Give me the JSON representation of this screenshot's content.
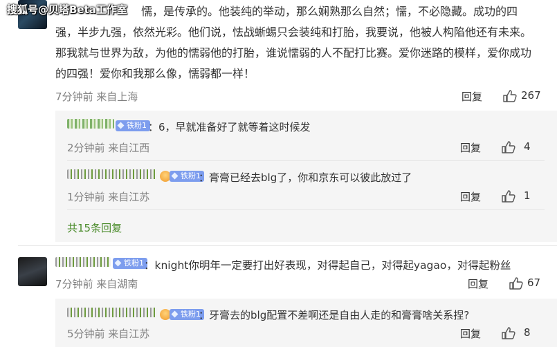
{
  "watermark": "搜狐号@贝塔Beta工作室",
  "comment1": {
    "text_lines": [
      "懦，是传承的。他装纯的举动，那么娴熟那么自然；懦，不必隐藏。成功的四",
      "强，半步九强，依然光彩。他们说，怯战蜥蜴只会装纯和打胎，我要说，他被人构陷他还有未来。",
      "那我就与世界为敌，为他的懦弱他的打胎，谁说懦弱的人不配打比赛。爱你迷路的模样，爱你成功",
      "的四强！爱你和我那么像，懦弱都一样！"
    ],
    "meta": "7分钟前 来自上海",
    "reply": "回复",
    "likes": "267"
  },
  "replies1": [
    {
      "badge": "铁粉1",
      "crown": false,
      "text": "：6，早就准备好了就等着这时候发",
      "meta": "2分钟前 来自江西",
      "reply": "回复",
      "likes": "4"
    },
    {
      "badge": "铁粉1",
      "crown": true,
      "text": "：膏膏已经去blg了，你和京东可以彼此放过了",
      "meta": "1分钟前 来自江苏",
      "reply": "回复",
      "likes": "1"
    }
  ],
  "replies1_total": "共15条回复",
  "comment2": {
    "badge": "铁粉1",
    "text": "：knight你明年一定要打出好表现，对得起自己，对得起yagao，对得起粉丝",
    "meta": "7分钟前 来自湖南",
    "reply": "回复",
    "likes": "67"
  },
  "replies2": [
    {
      "badge": "铁粉1",
      "crown": true,
      "text": "：牙膏去的blg配置不差啊还是自由人走的和膏膏啥关系捏?",
      "meta": "5分钟前 来自江苏",
      "reply": "回复",
      "likes": "8"
    }
  ],
  "icons": {
    "like": "thumbs-up-icon",
    "badge": "diamond-icon",
    "crown": "crown-icon"
  },
  "colors": {
    "badge": "#7d9dee",
    "total_link": "#4a8b2a",
    "meta": "#808080",
    "reply_bg": "#f5f5f5"
  }
}
